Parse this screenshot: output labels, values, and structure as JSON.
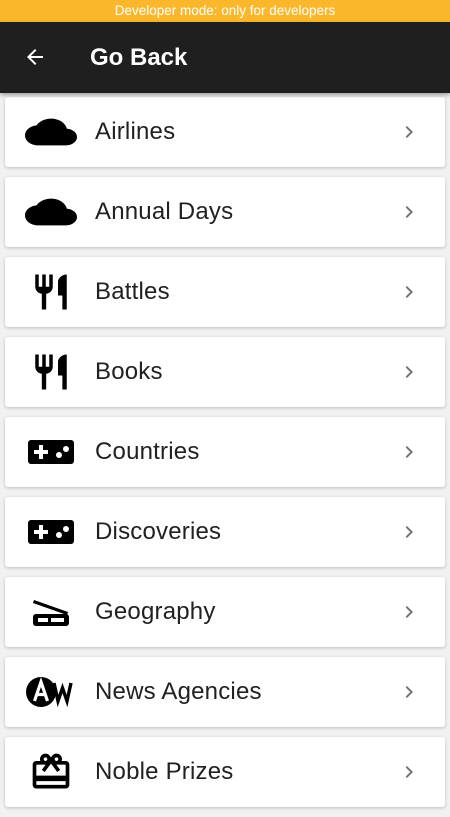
{
  "banner": {
    "text": "Developer mode: only for developers",
    "color": "#fbb72b"
  },
  "app_bar": {
    "title": "Go Back",
    "back_icon": "arrow-left-icon",
    "color": "#1f1f1f"
  },
  "items": [
    {
      "label": "Airlines",
      "icon": "cloud-icon"
    },
    {
      "label": "Annual Days",
      "icon": "cloud-icon"
    },
    {
      "label": "Battles",
      "icon": "restaurant-icon"
    },
    {
      "label": "Books",
      "icon": "restaurant-icon"
    },
    {
      "label": "Countries",
      "icon": "gamepad-icon"
    },
    {
      "label": "Discoveries",
      "icon": "gamepad-icon"
    },
    {
      "label": "Geography",
      "icon": "scanner-icon"
    },
    {
      "label": "News Agencies",
      "icon": "text-format-icon"
    },
    {
      "label": "Noble Prizes",
      "icon": "gift-card-icon"
    }
  ],
  "chevron_icon": "chevron-right-icon"
}
